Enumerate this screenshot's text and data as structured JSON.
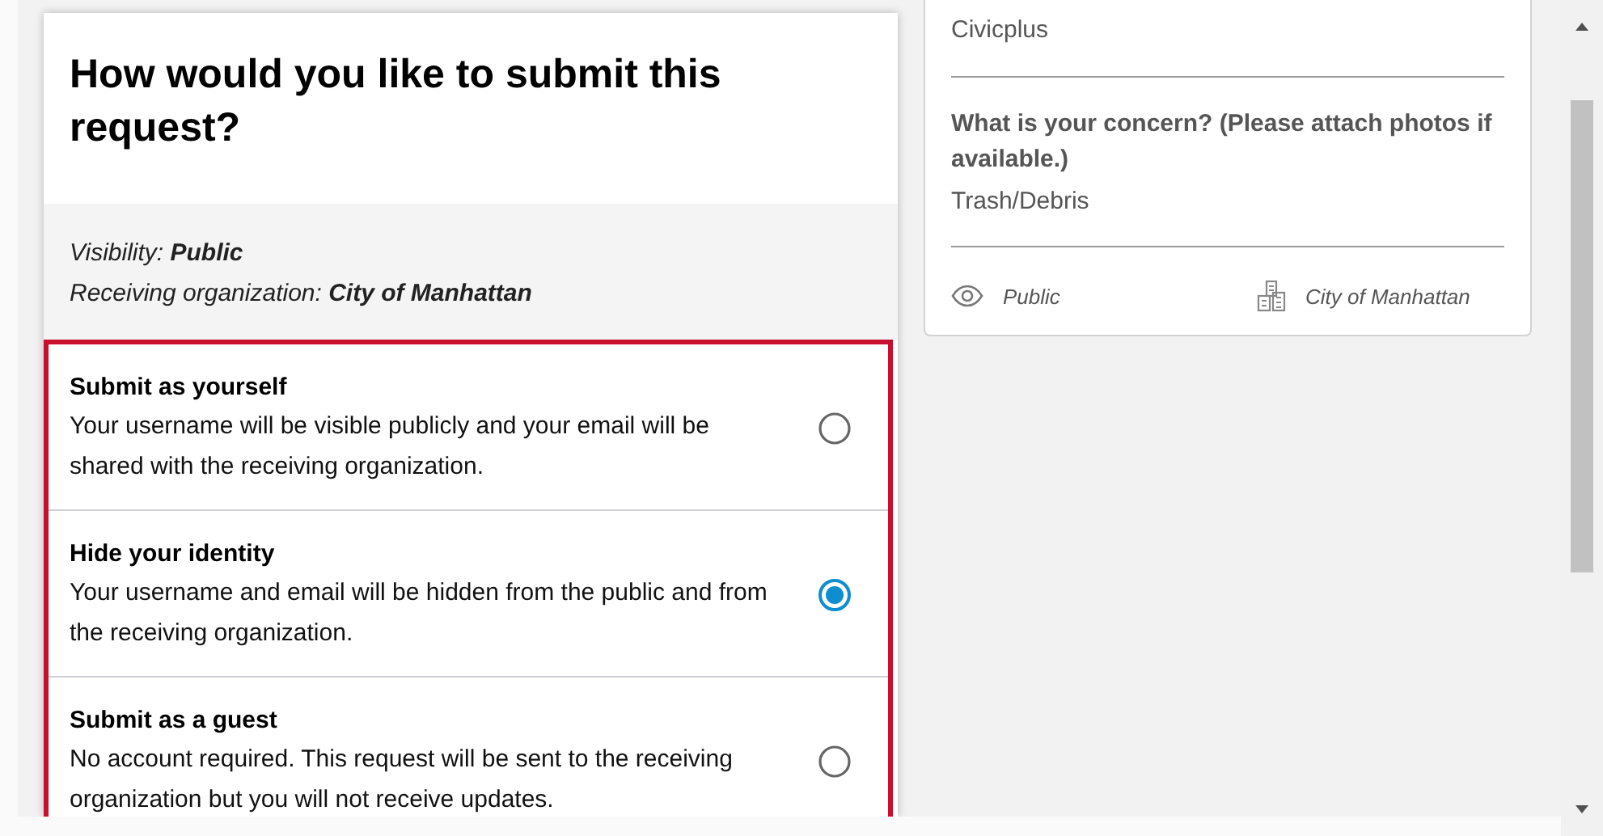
{
  "request": {
    "title": "How would you like to submit this request?",
    "visibility": "Visibility: **Public**",
    "organization": "Receiving organization: **City of Manhattan**"
  },
  "options": [
    {
      "title": "Submit as yourself",
      "description": "Your username will be visible publicly and your email will be shared with the receiving organization.",
      "selected": false
    },
    {
      "title": "Hide your identity",
      "description": "Your username and email will be hidden from the public and from the receiving organization.",
      "selected": true
    },
    {
      "title": "Submit as a guest",
      "description": "No account required. This request will be sent to the receiving organization but you will not receive updates.",
      "selected": false
    }
  ],
  "summary": {
    "author": "Civicplus",
    "question": "What is your concern? (Please attach photos if available.)",
    "answer": "Trash/Debris",
    "visibility": "Public",
    "organization": "City of Manhattan"
  }
}
